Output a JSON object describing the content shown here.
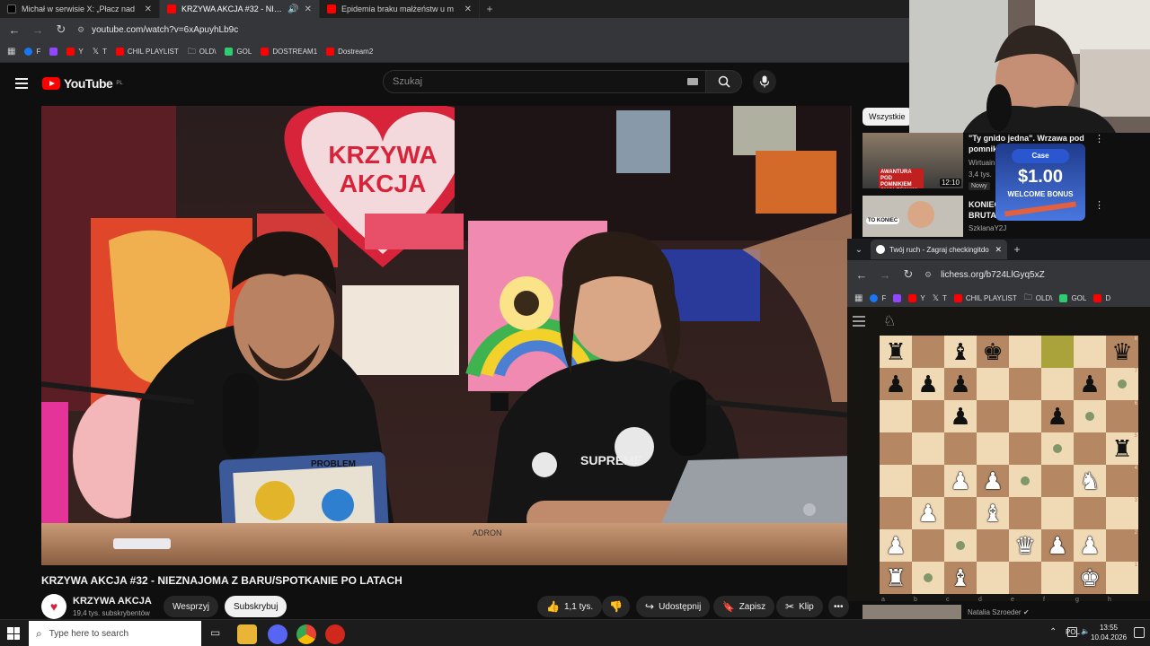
{
  "browser": {
    "tabs": [
      {
        "title": "Michał w serwisie X: „Płacz nad",
        "color": "#000000"
      },
      {
        "title": "KRZYWA AKCJA #32 - NIEZ",
        "color": "#ff0000"
      },
      {
        "title": "Epidemia braku małżeństw u m",
        "color": "#ff0000"
      }
    ],
    "url": "youtube.com/watch?v=6xApuyhLb9c",
    "bookmarks": [
      {
        "label": "F",
        "color": "#1877f2"
      },
      {
        "label": "",
        "color": "#9146ff"
      },
      {
        "label": "Y",
        "color": "#ff0000"
      },
      {
        "label": "T",
        "color": "#ffffff"
      },
      {
        "label": "CHIL PLAYLIST",
        "color": "#ff0000"
      },
      {
        "label": "OLD\\",
        "color": "#cccccc"
      },
      {
        "label": "GOL",
        "color": "#2ecc71"
      },
      {
        "label": "DOSTREAM1",
        "color": "#ff0000"
      },
      {
        "label": "Dostream2",
        "color": "#ff0000"
      }
    ]
  },
  "youtube": {
    "logo": "YouTube",
    "country": "PL",
    "search_placeholder": "Szukaj",
    "video_title": "KRZYWA AKCJA #32 - NIEZNAJOMA Z BARU/SPOTKANIE PO LATACH",
    "channel_name": "KRZYWA AKCJA",
    "subscribers": "19,4 tys. subskrybentów",
    "support_label": "Wesprzyj",
    "subscribe_label": "Subskrybuj",
    "likes": "1,1 tys.",
    "share_label": "Udostępnij",
    "save_label": "Zapisz",
    "clip_label": "Klip",
    "video_scene": {
      "heart_sign_line1": "KRZYWA",
      "heart_sign_line2": "AKCJA",
      "tablet_sticker": "PROBLEM",
      "shirt_text": "SUPREME",
      "laptop_sticker": "ADRON"
    }
  },
  "sidebar": {
    "filter": "Wszystkie",
    "items": [
      {
        "title": "\"Ty gnido jedna\". Wrzawa pod",
        "title2": "pomnik",
        "channel": "Wirtuain",
        "meta": "3,4 tys.",
        "badge": "Nowy",
        "duration": "12:10",
        "thumb_text": "AWANTURA POD POMNIKIEM SMOLEŃSKIM"
      },
      {
        "title": "KONIEC",
        "title2": "BRUTA",
        "channel": "SzklanaY2J",
        "thumb_text": "TO KONIEC"
      }
    ],
    "bottom_channel": "Natalia Szroeder"
  },
  "overlay_ad": {
    "brand": "Case",
    "amount": "$1.00",
    "caption": "WELCOME BONUS"
  },
  "popup": {
    "tab_title": "Twój ruch - Zagraj checkingitdo",
    "url": "lichess.org/b724LlGyq5xZ",
    "bookmarks": [
      "F",
      "",
      "Y",
      "T",
      "CHIL PLAYLIST",
      "OLD\\",
      "GOL",
      "D"
    ],
    "files": [
      "a",
      "b",
      "c",
      "d",
      "e",
      "f",
      "g",
      "h"
    ],
    "ranks": [
      "8",
      "7",
      "6",
      "5",
      "4",
      "3",
      "2",
      "1"
    ],
    "board": [
      [
        "bR",
        "",
        "bB",
        "bK",
        "",
        "hl",
        "",
        "bQ"
      ],
      [
        "bP",
        "bP",
        "bP",
        "",
        "",
        "",
        "bP",
        "dot"
      ],
      [
        "",
        "",
        "bP",
        "",
        "",
        "bP",
        "dot",
        ""
      ],
      [
        "",
        "",
        "",
        "",
        "",
        "dot",
        "",
        "bR"
      ],
      [
        "",
        "",
        "wP",
        "wP",
        "dot",
        "",
        "wN",
        ""
      ],
      [
        "",
        "wP",
        "",
        "wB",
        "",
        "",
        "",
        ""
      ],
      [
        "wP",
        "",
        "dot",
        "",
        "wQ",
        "wP",
        "wP",
        ""
      ],
      [
        "wR",
        "dot",
        "wB",
        "",
        "",
        "",
        "wK",
        ""
      ]
    ]
  },
  "taskbar": {
    "search_placeholder": "Type here to search",
    "lang": "POL",
    "time": "13:55",
    "date": "10.04.2026"
  }
}
